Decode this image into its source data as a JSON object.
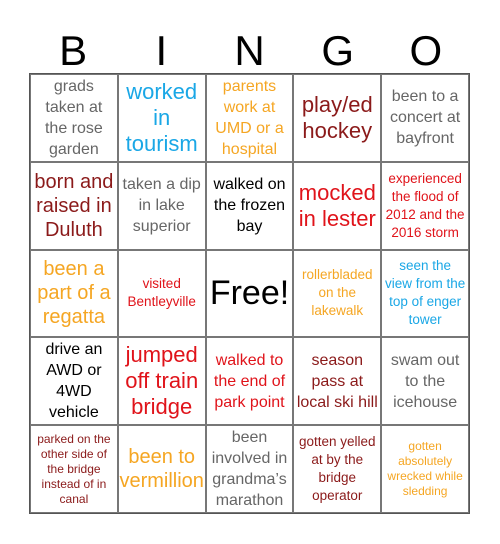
{
  "header": {
    "letters": [
      "B",
      "I",
      "N",
      "G",
      "O"
    ]
  },
  "colors": {
    "blue": "#1aa7e6",
    "orange": "#f5a623",
    "darkred": "#8b1a1a",
    "red": "#e0131a",
    "gray": "#666666",
    "black": "#000000"
  },
  "board": {
    "rows": [
      [
        {
          "text": "grads taken at the rose garden",
          "color": "gray",
          "size": "md"
        },
        {
          "text": "worked in tourism",
          "color": "blue",
          "size": "xl"
        },
        {
          "text": "parents work at UMD or a hospital",
          "color": "orange",
          "size": "md"
        },
        {
          "text": "play/ed hockey",
          "color": "darkred",
          "size": "xl"
        },
        {
          "text": "been to a concert at bayfront",
          "color": "gray",
          "size": "md"
        }
      ],
      [
        {
          "text": "born and raised in Duluth",
          "color": "darkred",
          "size": "lg"
        },
        {
          "text": "taken a dip in lake superior",
          "color": "gray",
          "size": "md"
        },
        {
          "text": "walked on the frozen bay",
          "color": "black",
          "size": "md"
        },
        {
          "text": "mocked in lester",
          "color": "red",
          "size": "xl"
        },
        {
          "text": "experienced the flood of 2012 and the 2016 storm",
          "color": "red",
          "size": "sm"
        }
      ],
      [
        {
          "text": "been a part of a regatta",
          "color": "orange",
          "size": "lg"
        },
        {
          "text": "visited Bentleyville",
          "color": "red",
          "size": "sm"
        },
        {
          "text": "Free!",
          "color": "black",
          "size": "free"
        },
        {
          "text": "rollerbladed on the lakewalk",
          "color": "orange",
          "size": "sm"
        },
        {
          "text": "seen the view from the top of enger tower",
          "color": "blue",
          "size": "sm"
        }
      ],
      [
        {
          "text": "drive an AWD or 4WD vehicle",
          "color": "black",
          "size": "md"
        },
        {
          "text": "jumped off train bridge",
          "color": "red",
          "size": "xl"
        },
        {
          "text": "walked to the end of park point",
          "color": "red",
          "size": "md"
        },
        {
          "text": "season pass at local ski hill",
          "color": "darkred",
          "size": "md"
        },
        {
          "text": "swam out to the icehouse",
          "color": "gray",
          "size": "md"
        }
      ],
      [
        {
          "text": "parked on the other side of the bridge instead of in canal",
          "color": "darkred",
          "size": "xs"
        },
        {
          "text": "been to vermillion",
          "color": "orange",
          "size": "lg"
        },
        {
          "text": "been involved in grandma’s marathon",
          "color": "gray",
          "size": "md"
        },
        {
          "text": "gotten yelled at by the bridge operator",
          "color": "darkred",
          "size": "sm"
        },
        {
          "text": "gotten absolutely wrecked while sledding",
          "color": "orange",
          "size": "xs"
        }
      ]
    ]
  }
}
